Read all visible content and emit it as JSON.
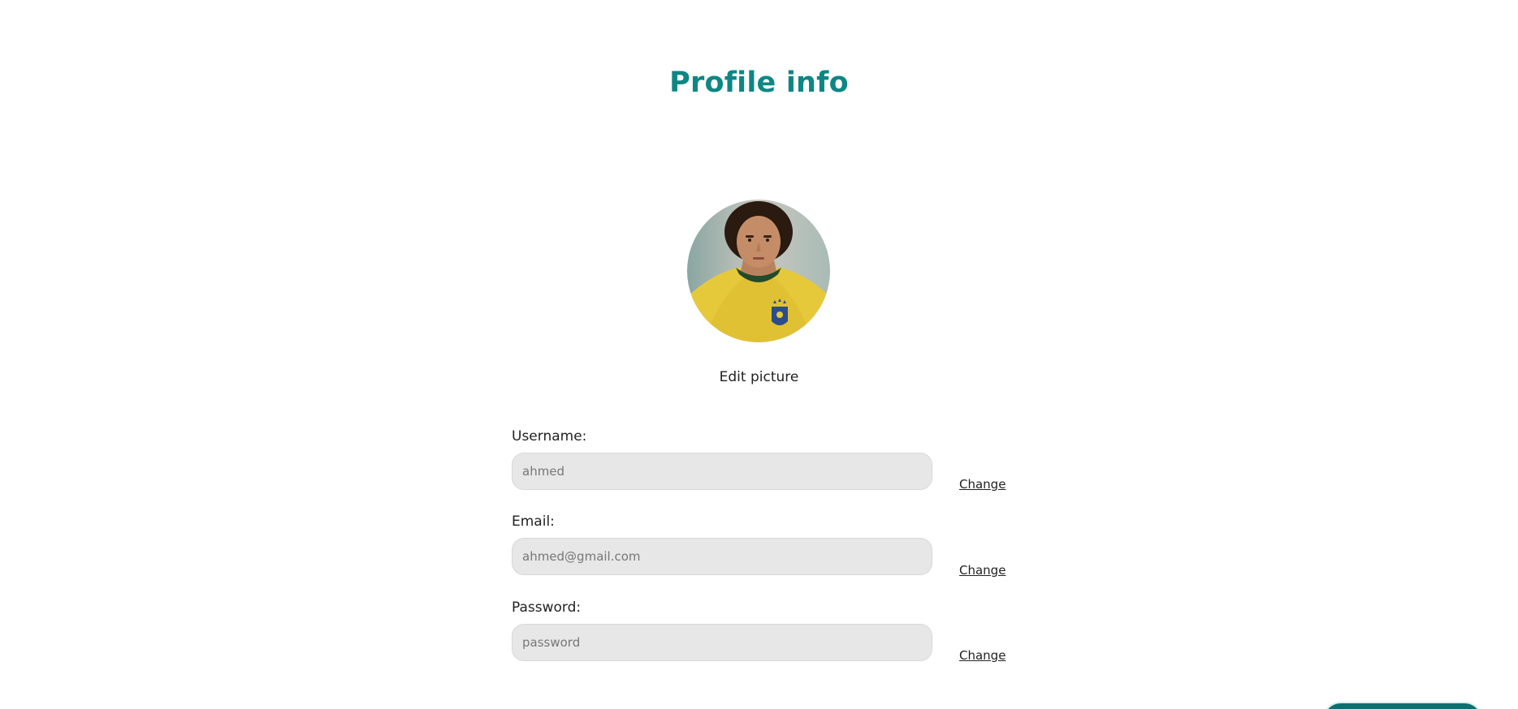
{
  "page": {
    "title": "Profile info",
    "edit_picture_label": "Edit picture"
  },
  "avatar": {
    "icon": "profile-photo"
  },
  "fields": {
    "username": {
      "label": "Username:",
      "value": "ahmed",
      "placeholder": "ahmed",
      "change_label": "Change"
    },
    "email": {
      "label": "Email:",
      "value": "ahmed@gmail.com",
      "placeholder": "ahmed@gmail.com",
      "change_label": "Change"
    },
    "password": {
      "label": "Password:",
      "value": "",
      "placeholder": "password",
      "change_label": "Change"
    }
  },
  "colors": {
    "accent": "#0e8684",
    "input_bg": "#e7e7e7",
    "button_bg": "#0e6f70"
  }
}
